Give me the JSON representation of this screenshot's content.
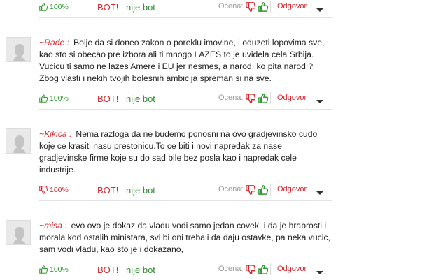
{
  "ui": {
    "bot_label": "BOT!",
    "notbot_label": "nije bot",
    "rating_label": "Ocena:",
    "reply_label": "Odgovor",
    "colors": {
      "accent_red": "#d9262c",
      "accent_green": "#2f9a2f"
    }
  },
  "comments": [
    {
      "author": "",
      "text": "",
      "percent": "100%",
      "percent_icon": "thumbs-up-icon"
    },
    {
      "author": "~Rade :",
      "text": "Bolje da si doneo zakon o poreklu imovine, i oduzeti lopovima sve, kao sto si obecao pre izbora ali ti mnogo LAZES to je uvidela cela Srbija. Vucicu ti samo ne lazes Amere i EU jer nesmes, a narod, ko pita narod!? Zbog vlasti i nekih tvojih bolesnih ambicija spreman si na sve.",
      "percent": "100%",
      "percent_icon": "thumbs-up-icon"
    },
    {
      "author": "~Kikica :",
      "text": "Nema razloga da ne budemo ponosni na ovo gradjevinsko cudo koje ce krasiti nasu prestonicu.To ce biti i novi napredak za nase gradjevinske firme koje su do sad bile bez posla kao i napredak cele industrije.",
      "percent": "100%",
      "percent_icon": "thumbs-down-icon"
    },
    {
      "author": "~misa :",
      "text": "evo ovo je dokaz da vladu vodi samo jedan covek, i da je hrabrosti i morala kod ostalih ministara, svi bi oni trebali da daju ostavke, pa neka vucic, sam vodi vladu, kao sto je i dokazano,",
      "percent": "100%",
      "percent_icon": "thumbs-up-icon"
    }
  ]
}
